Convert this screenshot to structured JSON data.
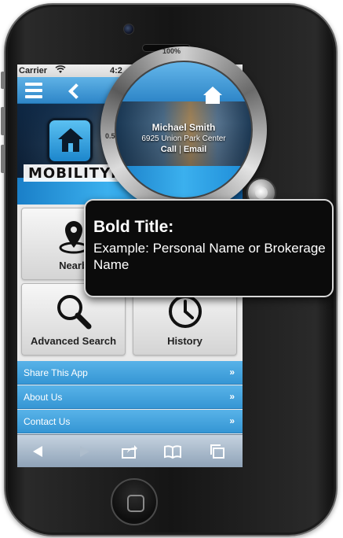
{
  "status_bar": {
    "carrier": "Carrier",
    "time": "4:2"
  },
  "header": {
    "logo_text": "MOBILITYR"
  },
  "tiles": [
    {
      "label": "Nearb",
      "icon": "location-pin-icon"
    },
    {
      "label": "",
      "icon": ""
    },
    {
      "label": "Advanced Search",
      "icon": "magnifier-icon"
    },
    {
      "label": "History",
      "icon": "clock-icon"
    }
  ],
  "list_items": [
    {
      "label": "Share This App",
      "chevron": "»"
    },
    {
      "label": "About Us",
      "chevron": "»"
    },
    {
      "label": "Contact Us",
      "chevron": "»"
    }
  ],
  "magnifier": {
    "scale_top": "100%",
    "scale_left": "0.5",
    "name": "Michael Smith",
    "address": "6925 Union Park Center",
    "call_label": "Call",
    "separator": "|",
    "email_label": "Email"
  },
  "callout": {
    "title": "Bold Title:",
    "body": "Example: Personal Name or Brokerage Name"
  },
  "colors": {
    "nav_blue": "#2e86c8",
    "list_blue": "#3596d4",
    "callout_bg": "#0b0b0b"
  }
}
